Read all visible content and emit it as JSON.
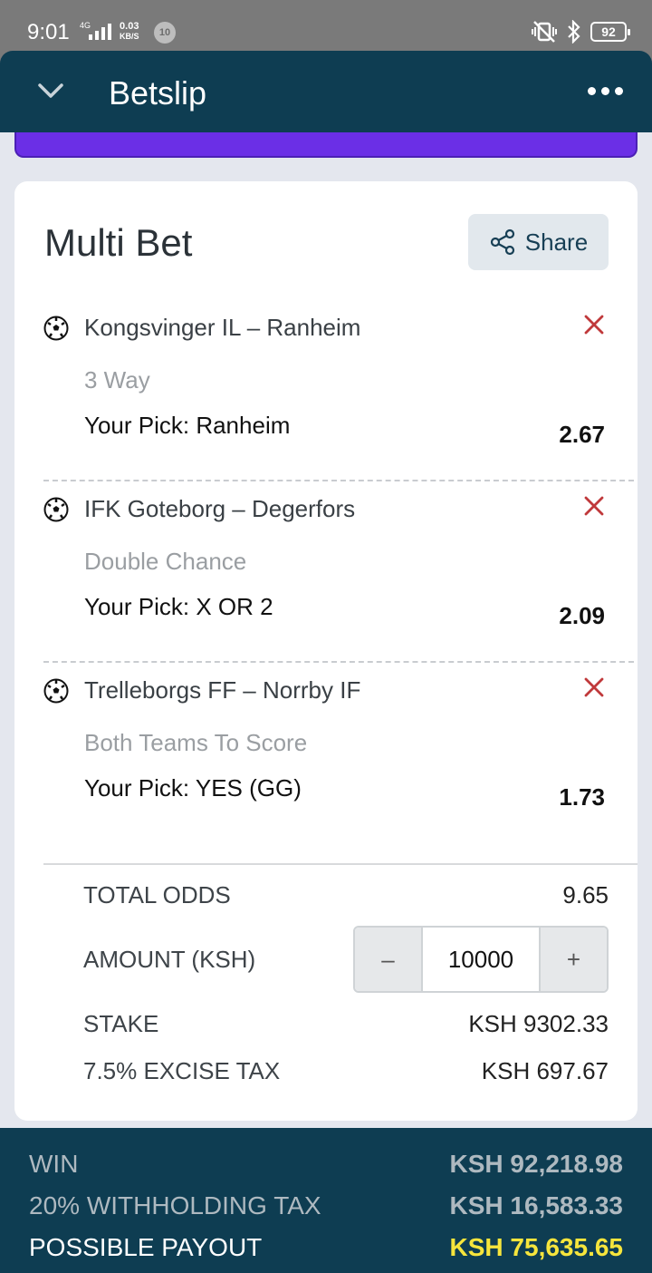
{
  "status_bar": {
    "time": "9:01",
    "network_type": "4G",
    "speed_value": "0.03",
    "speed_unit": "KB/S",
    "notification_count": "10",
    "battery": "92"
  },
  "header": {
    "title": "Betslip"
  },
  "card": {
    "title": "Multi Bet",
    "share_label": "Share"
  },
  "selections": [
    {
      "match": "Kongsvinger IL – Ranheim",
      "market": "3 Way",
      "pick": "Your Pick: Ranheim",
      "odds": "2.67"
    },
    {
      "match": "IFK Goteborg – Degerfors",
      "market": "Double Chance",
      "pick": "Your Pick: X OR 2",
      "odds": "2.09"
    },
    {
      "match": "Trelleborgs FF – Norrby IF",
      "market": "Both Teams To Score",
      "pick": "Your Pick: YES (GG)",
      "odds": "1.73"
    }
  ],
  "summary": {
    "total_odds_label": "TOTAL ODDS",
    "total_odds_value": "9.65",
    "amount_label": "AMOUNT (KSH)",
    "amount_value": "10000",
    "minus_label": "–",
    "plus_label": "+",
    "stake_label": "STAKE",
    "stake_value": "KSH 9302.33",
    "excise_label": "7.5% EXCISE TAX",
    "excise_value": "KSH 697.67"
  },
  "footer": {
    "win_label": "WIN",
    "win_value": "KSH 92,218.98",
    "withholding_label": "20% WITHHOLDING TAX",
    "withholding_value": "KSH 16,583.33",
    "payout_label": "POSSIBLE PAYOUT",
    "payout_value": "KSH 75,635.65"
  },
  "colors": {
    "header_bg": "#0e3d52",
    "accent_purple": "#6b2fe6",
    "remove_red": "#c0393b",
    "payout_yellow": "#f6e53c"
  },
  "icons": [
    "chevron-down-icon",
    "more-options-icon",
    "share-icon",
    "soccer-ball-icon",
    "remove-icon",
    "bluetooth-icon",
    "silent-vibrate-icon",
    "battery-icon",
    "signal-icon"
  ]
}
